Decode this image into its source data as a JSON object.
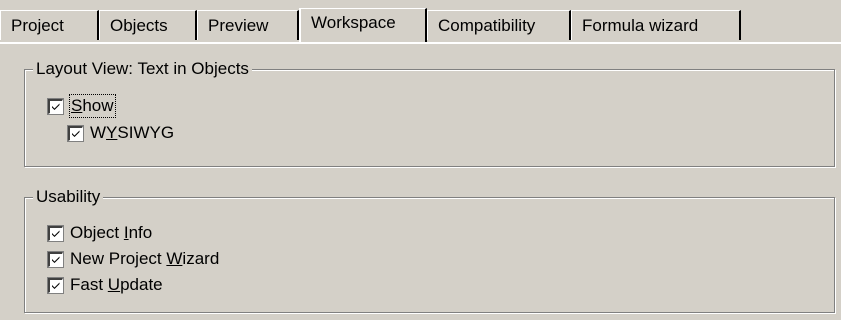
{
  "tabs": [
    {
      "label": "Project",
      "active": false
    },
    {
      "label": "Objects",
      "active": false
    },
    {
      "label": "Preview",
      "active": false
    },
    {
      "label": "Workspace",
      "active": true
    },
    {
      "label": "Compatibility",
      "active": false
    },
    {
      "label": "Formula wizard",
      "active": false
    }
  ],
  "layout_group": {
    "title": "Layout View: Text in Objects",
    "show": {
      "pre": "",
      "accel": "S",
      "post": "how",
      "checked": true
    },
    "wysiwyg": {
      "pre": "W",
      "accel": "Y",
      "post": "SIWYG",
      "checked": true
    }
  },
  "usability_group": {
    "title": "Usability",
    "object_info": {
      "pre": "Object ",
      "accel": "I",
      "post": "nfo",
      "checked": true
    },
    "new_project_wizard": {
      "pre": "New Project ",
      "accel": "W",
      "post": "izard",
      "checked": true
    },
    "fast_update": {
      "pre": "Fast ",
      "accel": "U",
      "post": "pdate",
      "checked": true
    }
  },
  "colors": {
    "face": "#d4d0c8",
    "highlight": "#ffffff",
    "shadow": "#808080",
    "dark": "#000000"
  }
}
